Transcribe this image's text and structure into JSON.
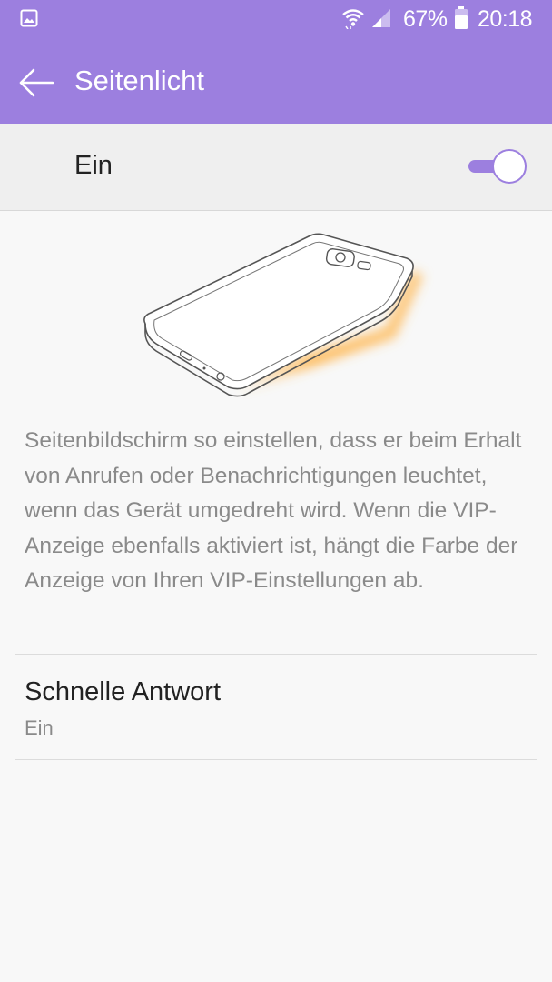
{
  "status": {
    "battery_percent": "67%",
    "time": "20:18",
    "icons": [
      "gallery-icon",
      "wifi-icon",
      "signal-icon",
      "battery-icon"
    ]
  },
  "appbar": {
    "title": "Seitenlicht"
  },
  "master_switch": {
    "label": "Ein",
    "on": true
  },
  "description": "Seitenbildschirm so einstellen, dass er beim Erhalt von Anrufen oder Benachrichtigungen leuchtet, wenn das Gerät umgedreht wird. Wenn die VIP-Anzeige ebenfalls aktiviert ist, hängt die Farbe der Anzeige von Ihren VIP-Einstellungen ab.",
  "settings": [
    {
      "title": "Schnelle Antwort",
      "value": "Ein"
    }
  ],
  "colors": {
    "accent": "#9c7fdf",
    "background": "#f8f8f8",
    "edge_glow": "#ffb347"
  }
}
